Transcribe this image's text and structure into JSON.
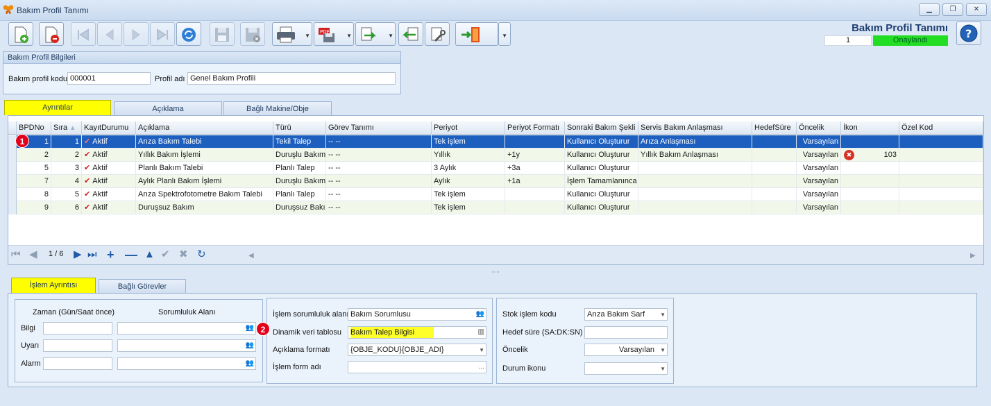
{
  "window": {
    "title": "Bakım Profil Tanımı",
    "minimize": "▁",
    "restore": "❐",
    "close": "✕"
  },
  "header": {
    "title": "Bakım Profil Tanımı",
    "record_no": "1",
    "status": "Onaylandı",
    "status_color": "#22dd22"
  },
  "profile_group": {
    "title": "Bakım Profil Bilgileri",
    "code_label": "Bakım profil kodu",
    "code_value": "000001",
    "name_label": "Profil adı",
    "name_value": "Genel Bakım Profili"
  },
  "tabs": [
    "Ayrıntılar",
    "Açıklama",
    "Bağlı Makine/Obje"
  ],
  "grid": {
    "columns": [
      "BPDNo",
      "Sıra",
      "KayıtDurumu",
      "Açıklama",
      "Türü",
      "Görev Tanımı",
      "Periyot",
      "Periyot Formatı",
      "Sonraki Bakım Şekli",
      "Servis Bakım Anlaşması",
      "HedefSüre",
      "Öncelik",
      "İkon",
      "Özel Kod"
    ],
    "rows": [
      {
        "bpdno": "1",
        "sira": "1",
        "durum": "Aktif",
        "aciklama": "Arıza Bakım Talebi",
        "turu": "Tekil Talep",
        "gorev": "-- --",
        "periyot": "Tek işlem",
        "format": "",
        "sonraki": "Kullanıcı Oluşturur",
        "servis": "Arıza Anlaşması",
        "hedef": "",
        "oncelik": "Varsayılan",
        "ikon": "",
        "ozel": ""
      },
      {
        "bpdno": "2",
        "sira": "2",
        "durum": "Aktif",
        "aciklama": "Yıllık Bakım İşlemi",
        "turu": "Duruşlu Bakım",
        "gorev": "-- --",
        "periyot": "Yıllık",
        "format": "+1y",
        "sonraki": "Kullanıcı Oluşturur",
        "servis": "Yıllık Bakım Anlaşması",
        "hedef": "",
        "oncelik": "Varsayılan",
        "ikon": "103",
        "ozel": ""
      },
      {
        "bpdno": "5",
        "sira": "3",
        "durum": "Aktif",
        "aciklama": "Planlı Bakım Talebi",
        "turu": "Planlı Talep",
        "gorev": "-- --",
        "periyot": "3 Aylık",
        "format": "+3a",
        "sonraki": "Kullanıcı Oluşturur",
        "servis": "",
        "hedef": "",
        "oncelik": "Varsayılan",
        "ikon": "",
        "ozel": ""
      },
      {
        "bpdno": "7",
        "sira": "4",
        "durum": "Aktif",
        "aciklama": "Aylık Planlı Bakım İşlemi",
        "turu": "Duruşlu Bakım",
        "gorev": "-- --",
        "periyot": "Aylık",
        "format": "+1a",
        "sonraki": "İşlem Tamamlanınca",
        "servis": "",
        "hedef": "",
        "oncelik": "Varsayılan",
        "ikon": "",
        "ozel": ""
      },
      {
        "bpdno": "8",
        "sira": "5",
        "durum": "Aktif",
        "aciklama": "Arıza Spektrofotometre Bakım Talebi",
        "turu": "Planlı Talep",
        "gorev": "-- --",
        "periyot": "Tek işlem",
        "format": "",
        "sonraki": "Kullanıcı Oluşturur",
        "servis": "",
        "hedef": "",
        "oncelik": "Varsayılan",
        "ikon": "",
        "ozel": ""
      },
      {
        "bpdno": "9",
        "sira": "6",
        "durum": "Aktif",
        "aciklama": "Duruşsuz Bakım",
        "turu": "Duruşsuz Bakım",
        "gorev": "-- --",
        "periyot": "Tek işlem",
        "format": "",
        "sonraki": "Kullanıcı Oluşturur",
        "servis": "",
        "hedef": "",
        "oncelik": "Varsayılan",
        "ikon": "",
        "ozel": ""
      }
    ],
    "navigator": {
      "position": "1 / 6"
    }
  },
  "badges": {
    "one": "1",
    "two": "2"
  },
  "subtabs": [
    "İşlem Ayrıntısı",
    "Bağlı Görevler"
  ],
  "detail_left": {
    "col_time": "Zaman (Gün/Saat önce)",
    "col_resp": "Sorumluluk Alanı",
    "rows": [
      "Bilgi",
      "Uyarı",
      "Alarm"
    ]
  },
  "detail_mid": {
    "resp_label": "İşlem sorumluluk alanı",
    "resp_value": "Bakım Sorumlusu",
    "table_label": "Dinamik veri tablosu",
    "table_value": "Bakım Talep Bilgisi",
    "format_label": "Açıklama formatı",
    "format_value": "{OBJE_KODU}{OBJE_ADI}",
    "form_label": "İşlem form adı",
    "form_value": "",
    "form_btn": "..."
  },
  "detail_right": {
    "stock_label": "Stok işlem kodu",
    "stock_value": "Arıza Bakım Sarf",
    "target_label": "Hedef süre (SA:DK:SN)",
    "target_value": "",
    "priority_label": "Öncelik",
    "priority_value": "Varsayılan",
    "icon_label": "Durum ikonu",
    "icon_value": ""
  }
}
